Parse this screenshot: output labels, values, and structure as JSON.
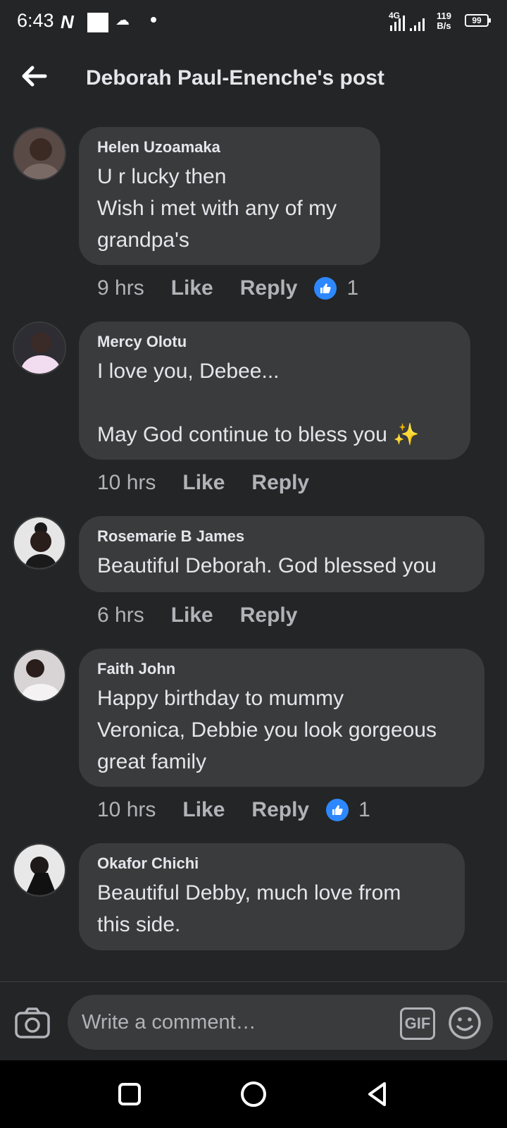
{
  "status_bar": {
    "time": "6:43",
    "network": "4G",
    "speed_value": "119",
    "speed_unit": "B/s",
    "battery": "99"
  },
  "header": {
    "title": "Deborah Paul-Enenche's post"
  },
  "comments": [
    {
      "author": "Helen Uzoamaka",
      "text": "U r lucky then\nWish i met with any of my\ngrandpa's",
      "time": "9 hrs",
      "like_label": "Like",
      "reply_label": "Reply",
      "reactions": "1"
    },
    {
      "author": "Mercy Olotu",
      "text": "I love you, Debee...\n\nMay God continue to bless you ✨",
      "time": "10 hrs",
      "like_label": "Like",
      "reply_label": "Reply"
    },
    {
      "author": "Rosemarie B James",
      "text": "Beautiful Deborah. God blessed you",
      "time": "6 hrs",
      "like_label": "Like",
      "reply_label": "Reply"
    },
    {
      "author": "Faith John",
      "text": "Happy birthday to mummy\nVeronica, Debbie you look gorgeous\ngreat family",
      "time": "10 hrs",
      "like_label": "Like",
      "reply_label": "Reply",
      "reactions": "1"
    },
    {
      "author": "Okafor Chichi",
      "text": "Beautiful  Debby, much love from\nthis side."
    }
  ],
  "compose": {
    "placeholder": "Write a comment…",
    "gif_label": "GIF"
  },
  "colors": {
    "background": "#242526",
    "bubble": "#3a3b3c",
    "like_blue": "#2d88ff",
    "text": "#e4e6eb",
    "secondary_text": "#b0b3b8"
  }
}
